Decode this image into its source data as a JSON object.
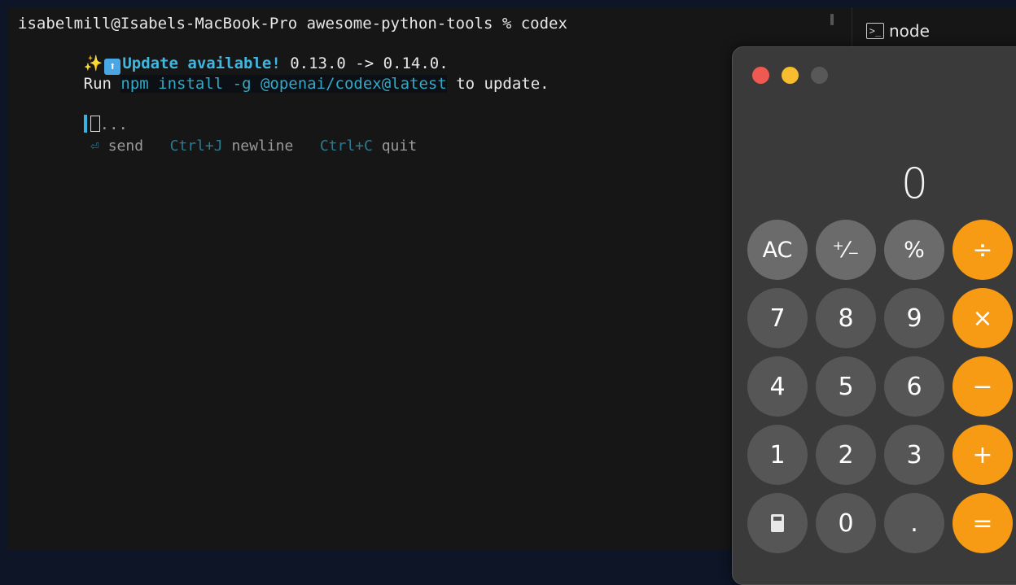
{
  "terminal": {
    "prompt": "isabelmill@Isabels-MacBook-Pro awesome-python-tools % codex",
    "update_banner": {
      "sparkle": "✨",
      "label": "Update available!",
      "versions": " 0.13.0 -> 0.14.0."
    },
    "run_line": {
      "prefix": "Run ",
      "command": "npm install -g @openai/codex@latest",
      "suffix": " to update."
    },
    "input_placeholder": "...",
    "hints": {
      "send_key": "⏎",
      "send_label": " send",
      "newline_key": "Ctrl+J",
      "newline_label": " newline",
      "quit_key": "Ctrl+C",
      "quit_label": " quit"
    }
  },
  "tab": {
    "label": "node"
  },
  "calculator": {
    "display": "0",
    "keys": [
      {
        "label": "AC",
        "kind": "fn"
      },
      {
        "label": "⁺⁄₋",
        "kind": "fn"
      },
      {
        "label": "%",
        "kind": "fn"
      },
      {
        "label": "÷",
        "kind": "op"
      },
      {
        "label": "7",
        "kind": "num"
      },
      {
        "label": "8",
        "kind": "num"
      },
      {
        "label": "9",
        "kind": "num"
      },
      {
        "label": "×",
        "kind": "op"
      },
      {
        "label": "4",
        "kind": "num"
      },
      {
        "label": "5",
        "kind": "num"
      },
      {
        "label": "6",
        "kind": "num"
      },
      {
        "label": "−",
        "kind": "op"
      },
      {
        "label": "1",
        "kind": "num"
      },
      {
        "label": "2",
        "kind": "num"
      },
      {
        "label": "3",
        "kind": "num"
      },
      {
        "label": "+",
        "kind": "op"
      },
      {
        "label": "",
        "kind": "num",
        "icon": "calculator-icon"
      },
      {
        "label": "0",
        "kind": "num"
      },
      {
        "label": ".",
        "kind": "num"
      },
      {
        "label": "=",
        "kind": "op"
      }
    ],
    "colors": {
      "close": "#ee5a52",
      "minimize": "#f5bd2f",
      "zoom": "#585858",
      "operator": "#f79a14"
    }
  }
}
